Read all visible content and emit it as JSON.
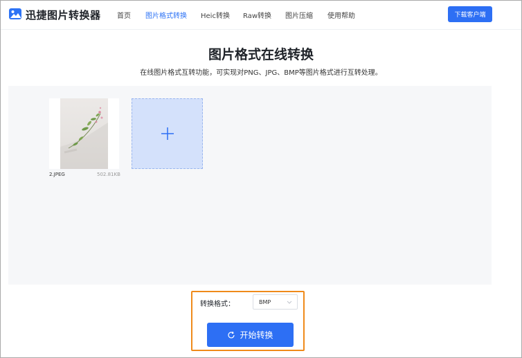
{
  "header": {
    "brand": "迅捷图片转换器",
    "nav": [
      {
        "label": "首页",
        "active": false
      },
      {
        "label": "图片格式转换",
        "active": true
      },
      {
        "label": "Heic转换",
        "active": false
      },
      {
        "label": "Raw转换",
        "active": false
      },
      {
        "label": "图片压缩",
        "active": false
      },
      {
        "label": "使用帮助",
        "active": false
      }
    ],
    "download_label": "下载客户端"
  },
  "main": {
    "title": "图片格式在线转换",
    "subtitle": "在线图片格式互转功能，可实现对PNG、JPG、BMP等图片格式进行互转处理。"
  },
  "files": [
    {
      "name": "2.JPEG",
      "size": "502.81KB"
    }
  ],
  "convert": {
    "format_label": "转换格式：",
    "format_value": "BMP",
    "start_label": "开始转换"
  },
  "colors": {
    "accent": "#2d6ff4",
    "highlight": "#ef8a1a",
    "add_box": "#d4e1fb"
  }
}
